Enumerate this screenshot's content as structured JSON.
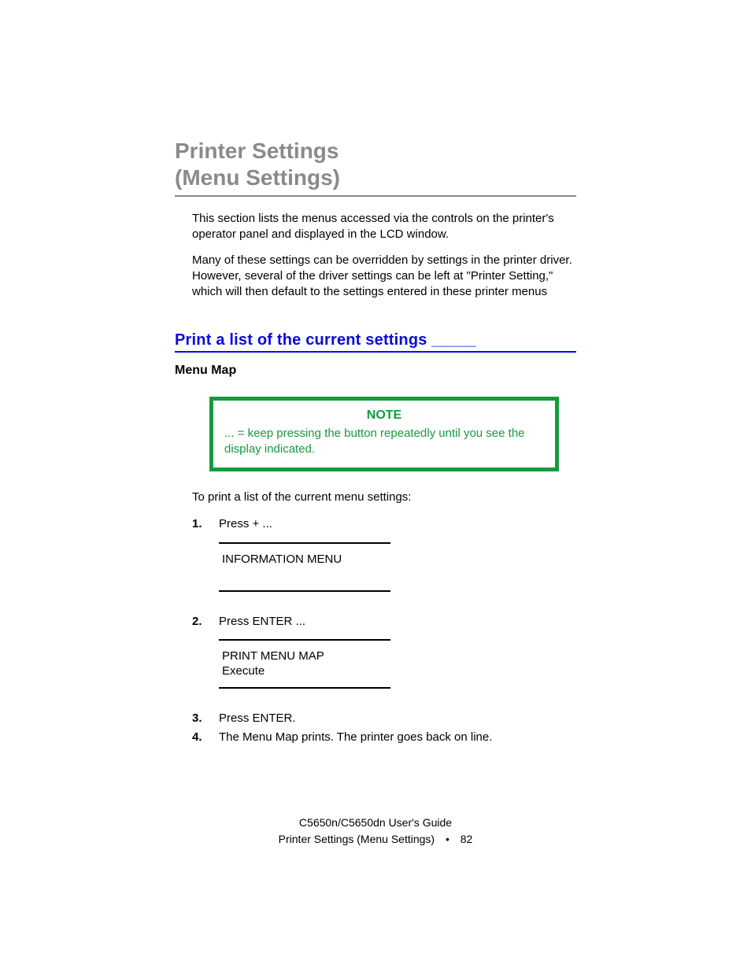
{
  "title_line1": "Printer Settings",
  "title_line2": " (Menu Settings)",
  "intro_p1": "This section lists the menus accessed via the controls on the printer's operator panel and displayed in the LCD window.",
  "intro_p2": "Many of these settings can be overridden by settings in the printer driver. However, several of the driver settings can be left at \"Printer Setting,\" which will then default to the settings entered in these printer menus",
  "section_heading": "Print a list of the current settings  _____",
  "subsection_heading": "Menu Map",
  "note_label": "NOTE",
  "note_body": "... = keep pressing the button repeatedly until you see the display indicated.",
  "lead_sentence": "To print a list of the current menu settings:",
  "steps": {
    "s1_num": "1.",
    "s1_text": "Press  +  ...",
    "s1_display_line1": "INFORMATION MENU",
    "s2_num": "2.",
    "s2_text": "Press  ENTER  ...",
    "s2_display_line1": "PRINT MENU MAP",
    "s2_display_line2": "Execute",
    "s3_num": "3.",
    "s3_text": "Press  ENTER.",
    "s4_num": "4.",
    "s4_text": "The Menu Map prints.  The printer goes back on line."
  },
  "footer_line1": "C5650n/C5650dn User's Guide",
  "footer_section": "Printer Settings (Menu Settings)",
  "footer_bullet": "•",
  "footer_page": "82"
}
